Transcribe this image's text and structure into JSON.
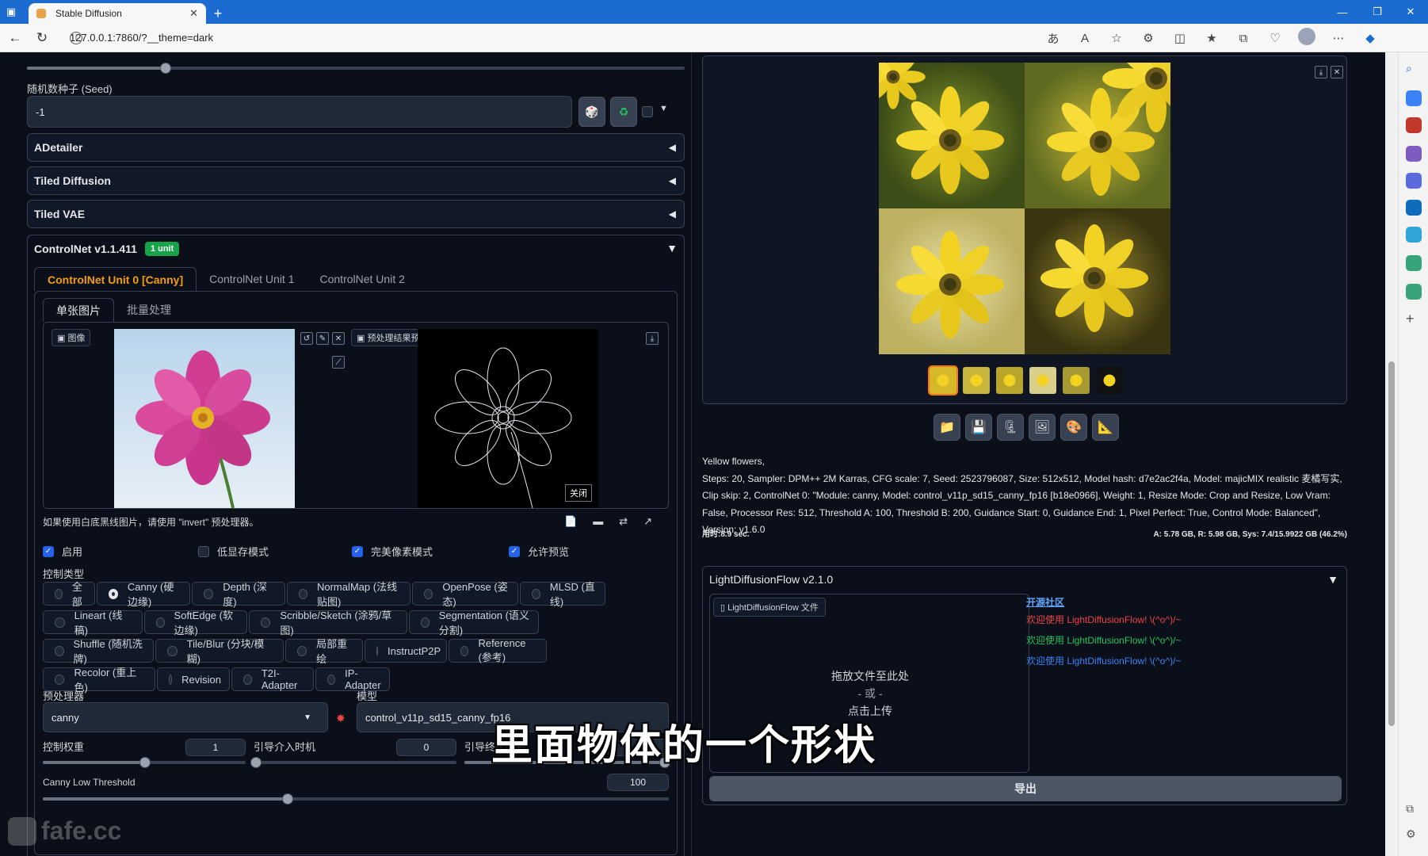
{
  "browser": {
    "tab_title": "Stable Diffusion",
    "url": "127.0.0.1:7860/?__theme=dark"
  },
  "seed": {
    "label": "随机数种子 (Seed)",
    "value": "-1"
  },
  "accordions": {
    "adetailer": "ADetailer",
    "tiled_diffusion": "Tiled Diffusion",
    "tiled_vae": "Tiled VAE"
  },
  "controlnet": {
    "title": "ControlNet v1.1.411",
    "badge": "1 unit",
    "unit_tabs": [
      "ControlNet Unit 0 [Canny]",
      "ControlNet Unit 1",
      "ControlNet Unit 2"
    ],
    "mode_tabs": [
      "单张图片",
      "批量处理"
    ],
    "image_label": "图像",
    "preview_label": "预处理结果预览",
    "close_label": "关闭",
    "hint": "如果使用白底黑线图片，请使用 \"invert\" 预处理器。",
    "checks": [
      {
        "label": "启用",
        "checked": true
      },
      {
        "label": "低显存模式",
        "checked": false
      },
      {
        "label": "完美像素模式",
        "checked": true
      },
      {
        "label": "允许预览",
        "checked": true
      }
    ],
    "control_type_label": "控制类型",
    "control_types": [
      [
        "全部",
        "Canny (硬边缘)",
        "Depth (深度)",
        "NormalMap (法线贴图)",
        "OpenPose (姿态)",
        "MLSD (直线)"
      ],
      [
        "Lineart (线稿)",
        "SoftEdge (软边缘)",
        "Scribble/Sketch (涂鸦/草图)",
        "Segmentation (语义分割)"
      ],
      [
        "Shuffle (随机洗牌)",
        "Tile/Blur (分块/模糊)",
        "局部重绘",
        "InstructP2P",
        "Reference (参考)"
      ],
      [
        "Recolor (重上色)",
        "Revision",
        "T2I-Adapter",
        "IP-Adapter"
      ]
    ],
    "selected_type": "Canny (硬边缘)",
    "preprocessor_label": "预处理器",
    "preprocessor": "canny",
    "model_label": "模型",
    "model": "control_v11p_sd15_canny_fp16",
    "weight_label": "控制权重",
    "weight": "1",
    "start_label": "引导介入时机",
    "start": "0",
    "end_label": "引导终止时机",
    "end": "1",
    "canny_low_label": "Canny Low Threshold",
    "canny_low": "100"
  },
  "output": {
    "prompt": "Yellow flowers,",
    "params": "Steps: 20, Sampler: DPM++ 2M Karras, CFG scale: 7, Seed: 2523796087, Size: 512x512, Model hash: d7e2ac2f4a, Model: majicMIX realistic 麦橘写实, Clip skip: 2, ControlNet 0: \"Module: canny, Model: control_v11p_sd15_canny_fp16 [b18e0966], Weight: 1, Resize Mode: Crop and Resize, Low Vram: False, Processor Res: 512, Threshold A: 100, Threshold B: 200, Guidance Start: 0, Guidance End: 1, Pixel Perfect: True, Control Mode: Balanced\", Version: v1.6.0",
    "time": "用时:8.9 sec.",
    "vram": "A: 5.78 GB, R: 5.98 GB, Sys: 7.4/15.9922 GB (46.2%)"
  },
  "ldf": {
    "title": "LightDiffusionFlow v2.1.0",
    "file_label": "LightDiffusionFlow 文件",
    "drop": "拖放文件至此处",
    "or": "- 或 -",
    "upload": "点击上传",
    "community": "开源社区",
    "welcome": [
      "欢迎使用 LightDiffusionFlow! \\(^o^)/~",
      "欢迎使用 LightDiffusionFlow! \\(^o^)/~",
      "欢迎使用 LightDiffusionFlow! \\(^o^)/~"
    ],
    "export": "导出"
  },
  "subtitle": "里面物体的一个形状",
  "watermark": "fafe.cc",
  "colors": {
    "accent": "#2563eb",
    "badge": "#16a34a",
    "orange": "#f97316"
  }
}
